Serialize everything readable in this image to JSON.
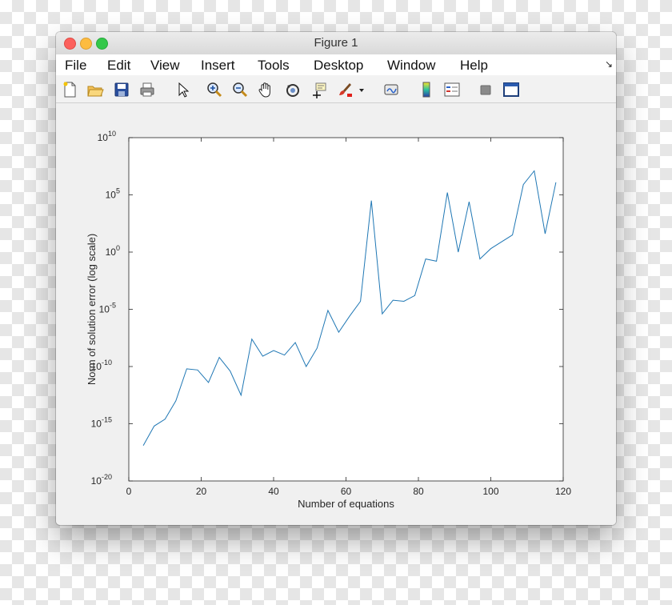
{
  "window": {
    "title": "Figure 1"
  },
  "menu": {
    "items": [
      "File",
      "Edit",
      "View",
      "Insert",
      "Tools",
      "Desktop",
      "Window",
      "Help"
    ],
    "corner_arrow": "↘"
  },
  "toolbar": {
    "icons": [
      "new-figure-icon",
      "open-file-icon",
      "save-icon",
      "print-icon",
      "pointer-icon",
      "zoom-in-icon",
      "zoom-out-icon",
      "pan-icon",
      "rotate-3d-icon",
      "data-cursor-icon",
      "brush-icon",
      "brush-dropdown-icon",
      "link-plot-icon",
      "colorbar-icon",
      "legend-icon",
      "hide-tools-icon",
      "show-tools-icon"
    ]
  },
  "colors": {
    "line": "#1f77b4",
    "axes_bg": "#ffffff",
    "figure_bg": "#f0f0f0"
  },
  "chart_data": {
    "type": "line",
    "xlabel": "Number of equations",
    "ylabel": "Norm of solution error (log scale)",
    "x_scale": "linear",
    "y_scale": "log",
    "xlim": [
      0,
      120
    ],
    "ylim_exponent": [
      -20,
      10
    ],
    "x_ticks": [
      "0",
      "20",
      "40",
      "60",
      "80",
      "100",
      "120"
    ],
    "y_ticks": [
      {
        "base": "10",
        "exp": "-20"
      },
      {
        "base": "10",
        "exp": "-15"
      },
      {
        "base": "10",
        "exp": "-10"
      },
      {
        "base": "10",
        "exp": "-5"
      },
      {
        "base": "10",
        "exp": "0"
      },
      {
        "base": "10",
        "exp": "5"
      },
      {
        "base": "10",
        "exp": "10"
      }
    ],
    "grid": false,
    "series": [
      {
        "x": [
          4,
          7,
          10,
          13,
          16,
          19,
          22,
          25,
          28,
          31,
          34,
          37,
          40,
          43,
          46,
          49,
          52,
          55,
          58,
          61,
          64,
          67,
          70,
          73,
          76,
          79,
          82,
          85,
          88,
          91,
          94,
          97,
          100,
          103,
          106,
          109,
          112,
          115,
          118
        ],
        "y_log10": [
          -16.9,
          -15.2,
          -14.6,
          -13.0,
          -10.2,
          -10.3,
          -11.4,
          -9.2,
          -10.4,
          -12.5,
          -7.6,
          -9.1,
          -8.6,
          -9.0,
          -7.9,
          -10.0,
          -8.4,
          -5.1,
          -7.0,
          -5.6,
          -4.3,
          4.5,
          -5.4,
          -4.2,
          -4.3,
          -3.8,
          -0.6,
          -0.8,
          5.2,
          0.0,
          4.4,
          -0.6,
          0.3,
          0.9,
          1.5,
          5.9,
          7.1,
          1.6,
          6.1
        ]
      }
    ]
  }
}
